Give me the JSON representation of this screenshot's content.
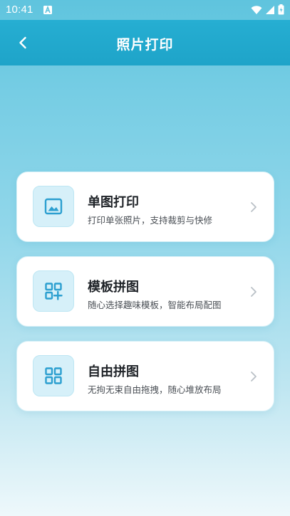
{
  "status_bar": {
    "time": "10:41",
    "app_icon": "a-letter-icon",
    "icons": [
      "wifi-icon",
      "signal-icon",
      "battery-charging-icon"
    ]
  },
  "header": {
    "title": "照片打印",
    "back_icon": "chevron-left-icon"
  },
  "cards": [
    {
      "title": "单图打印",
      "description": "打印单张照片，支持裁剪与快修",
      "icon": "image-icon"
    },
    {
      "title": "模板拼图",
      "description": "随心选择趣味模板，智能布局配图",
      "icon": "grid-add-icon"
    },
    {
      "title": "自由拼图",
      "description": "无拘无束自由拖拽，随心堆放布局",
      "icon": "grid-icon"
    }
  ],
  "colors": {
    "accent": "#1ea4c9",
    "icon_blue": "#2c9fd0",
    "icon_bg": "#d6f0f9",
    "chevron": "#b9c0c6"
  }
}
